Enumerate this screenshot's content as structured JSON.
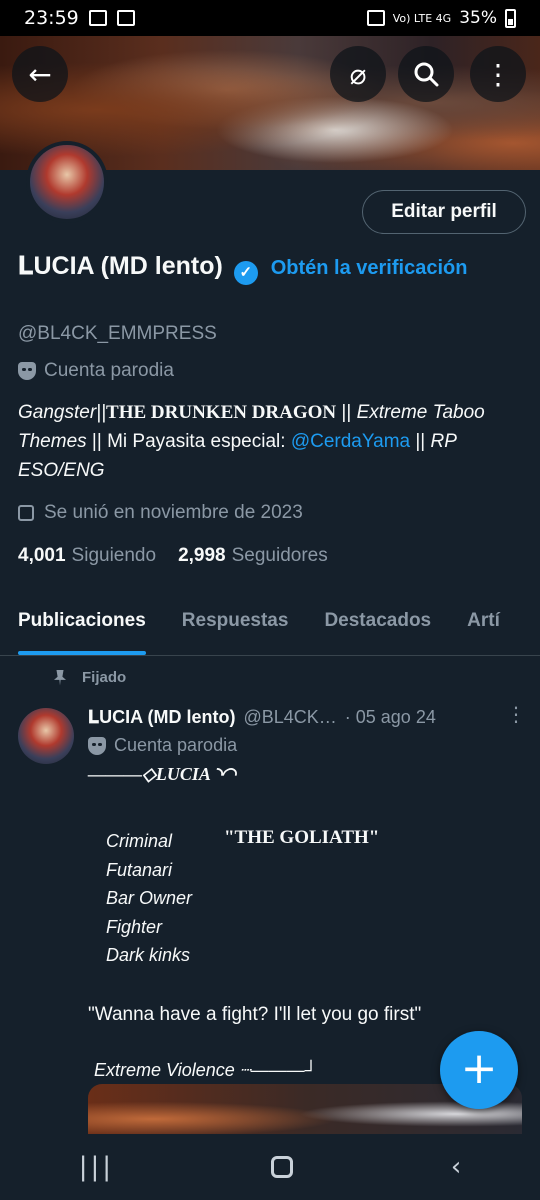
{
  "status_bar": {
    "time": "23:59",
    "network": "Vo) LTE 4G",
    "battery": "35%"
  },
  "header": {
    "back_icon": "arrow-left-icon",
    "grok_icon": "slashed-circle-icon",
    "search_icon": "search-icon",
    "more_icon": "more-vertical-icon"
  },
  "profile": {
    "edit_label": "Editar perfil",
    "display_name": "𝐋UCIA (MD lento)",
    "verify_link": "Obtén la verificación",
    "handle": "@BL4CK_EMMPRESS",
    "parody_label": "Cuenta parodia",
    "bio": {
      "part1": "Gangster||",
      "part2": "THE DRUNKEN DRAGON",
      "part3": " || ",
      "part4": "Extreme Taboo Themes",
      "part5": " || Mi Payasita especial: ",
      "mention": "@CerdaYama",
      "part6": " || ",
      "part7": "RP ESO/ENG"
    },
    "joined": "Se unió en noviembre de 2023",
    "following_count": "4,001",
    "following_label": "Siguiendo",
    "followers_count": "2,998",
    "followers_label": "Seguidores"
  },
  "tabs": [
    "Publicaciones",
    "Respuestas",
    "Destacados",
    "Artí"
  ],
  "pinned_label": "Fijado",
  "post": {
    "name": "𝐋UCIA (MD lento)",
    "handle": "@BL4CK…",
    "date": "· 05 ago 24",
    "parody_label": "Cuenta parodia",
    "deco_line": "———◇LUCIA ◝◜◝",
    "roles": [
      "Criminal",
      "Futanari",
      "Bar Owner",
      "Fighter",
      "Dark kinks"
    ],
    "goliath": "\"THE GOLIATH\"",
    "quote": "\"Wanna have a fight? I'll let you go first\"",
    "extreme": "Extreme Violence   ┈———┘"
  },
  "fab_icon": "plus-icon",
  "navbar": {
    "recents": "|||",
    "back": "‹"
  },
  "colors": {
    "accent": "#1d9bf0",
    "background": "#15202b",
    "muted": "#8b98a5"
  }
}
